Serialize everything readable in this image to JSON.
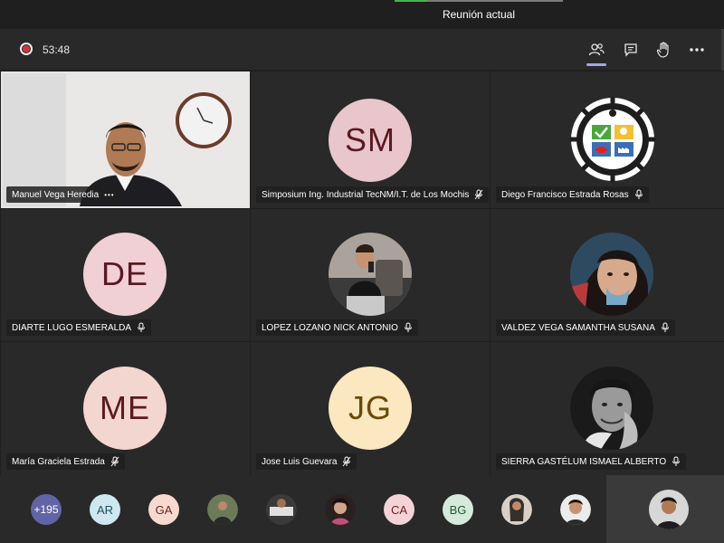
{
  "window": {
    "title": "Reunión actual"
  },
  "toolbar": {
    "timer": "53:48",
    "icons": [
      "record-icon",
      "participants-icon",
      "chat-icon",
      "raise-hand-icon",
      "more-icon"
    ]
  },
  "tiles": [
    {
      "name": "Manuel Vega Heredia",
      "type": "video",
      "more": "•••"
    },
    {
      "name": "Simposium Ing. Industrial TecNM/I.T. de Los Mochis",
      "initials": "SM",
      "bg": "#e9c6cb",
      "fg": "#5a1a22"
    },
    {
      "name": "Diego Francisco Estrada Rosas",
      "type": "logo"
    },
    {
      "name": "DIARTE LUGO ESMERALDA",
      "initials": "DE",
      "bg": "#f0d0d4",
      "fg": "#5a1a22"
    },
    {
      "name": "LOPEZ LOZANO NICK ANTONIO",
      "type": "photo"
    },
    {
      "name": "VALDEZ VEGA SAMANTHA SUSANA",
      "type": "photo"
    },
    {
      "name": "María Graciela Estrada",
      "initials": "ME",
      "bg": "#f3d6cf",
      "fg": "#5a1a22"
    },
    {
      "name": "Jose Luis Guevara",
      "initials": "JG",
      "bg": "#fbe8c0",
      "fg": "#6b4a05"
    },
    {
      "name": "SIERRA GASTÉLUM ISMAEL ALBERTO",
      "type": "photo"
    }
  ],
  "tray": {
    "overflow": "+195",
    "avatars": [
      {
        "initials": "AR",
        "bg": "#cfe7ef",
        "fg": "#1f4e5c"
      },
      {
        "initials": "GA",
        "bg": "#f6d9cf",
        "fg": "#6a2a1a"
      },
      {
        "initials": "",
        "type": "photo"
      },
      {
        "initials": "",
        "type": "photo"
      },
      {
        "initials": "",
        "type": "photo"
      },
      {
        "initials": "CA",
        "bg": "#f4d3d6",
        "fg": "#6a1f2a"
      },
      {
        "initials": "BG",
        "bg": "#d6eadb",
        "fg": "#1f5a2e"
      },
      {
        "initials": "",
        "type": "photo"
      },
      {
        "initials": "",
        "type": "photo"
      }
    ]
  },
  "colors": {
    "background": "#1f1f1f",
    "tile": "#292929",
    "accent": "#a6a7dc",
    "recording": "#d13438"
  }
}
